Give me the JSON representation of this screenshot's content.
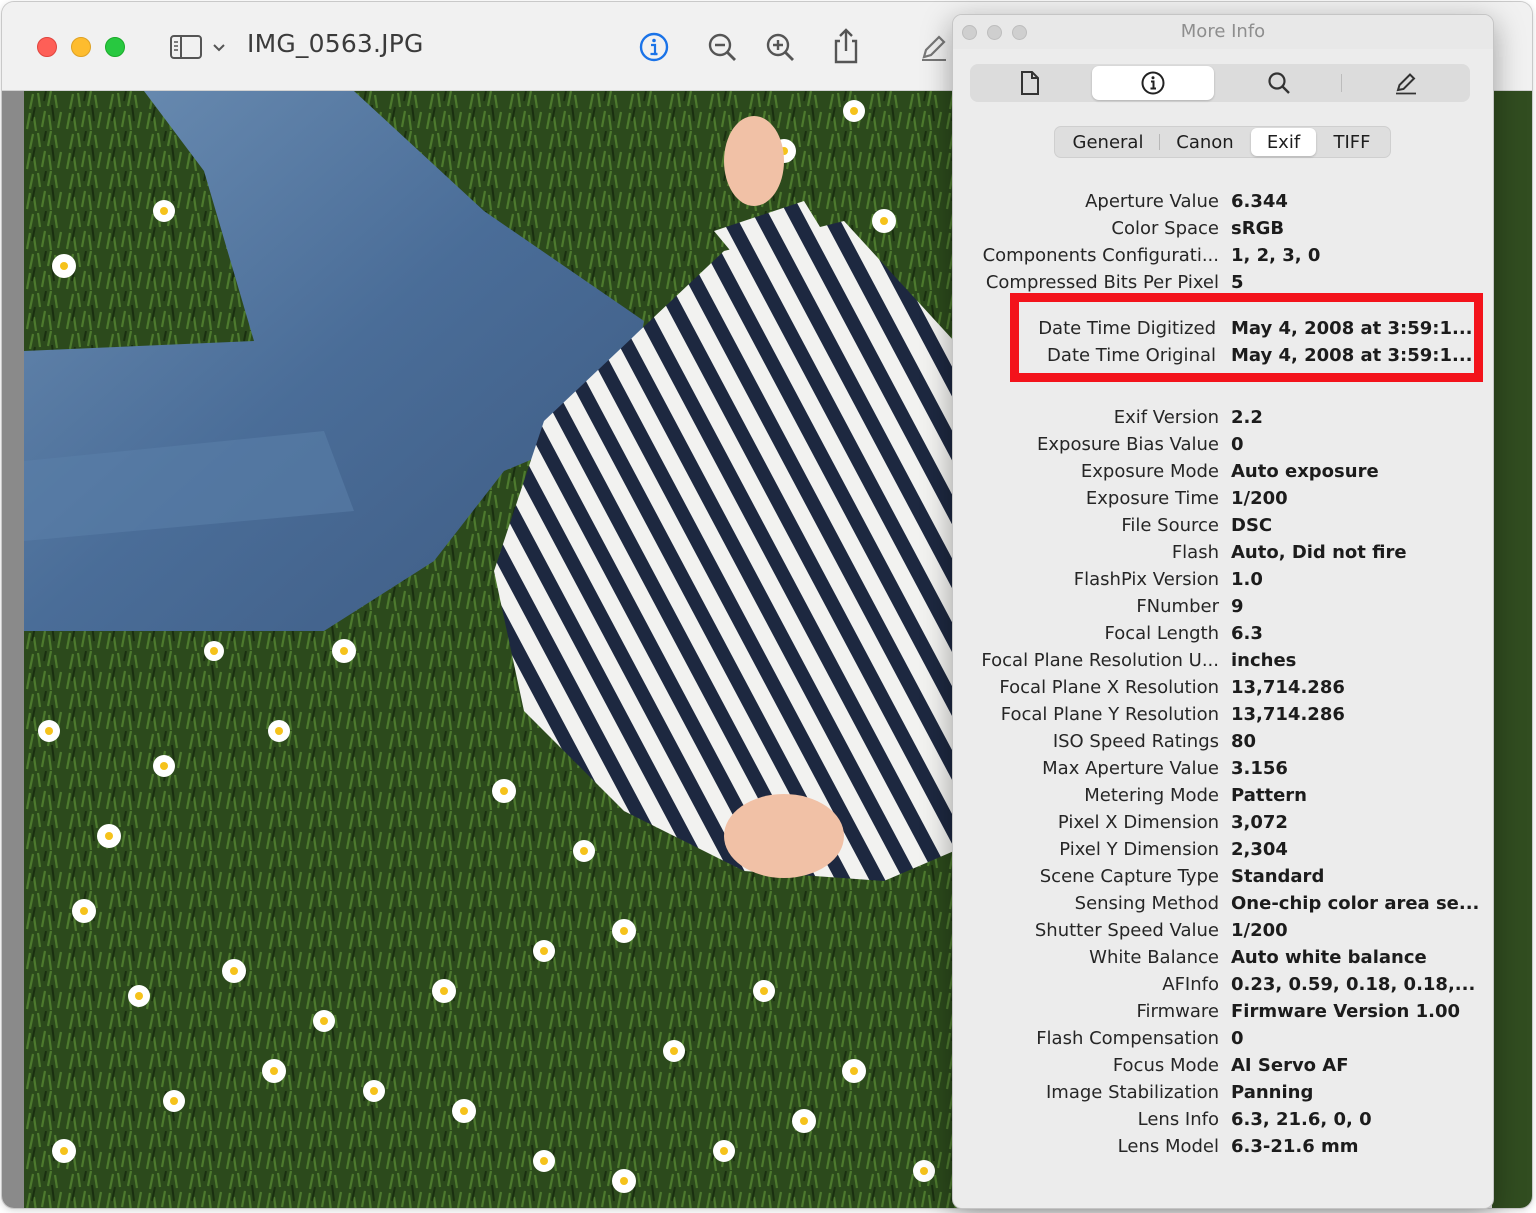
{
  "window": {
    "title": "IMG_0563.JPG"
  },
  "toolbar": {
    "icons": [
      "sidebar-icon",
      "chevron-down-icon",
      "info-icon",
      "zoom-out-icon",
      "zoom-in-icon",
      "share-icon",
      "markup-icon"
    ],
    "accent_color": "#1a73e8"
  },
  "inspector": {
    "title": "More Info",
    "tabs": [
      "document-icon",
      "info-icon",
      "search-icon",
      "pencil-icon"
    ],
    "selected_tab": "info-icon",
    "subtabs": [
      "General",
      "Canon",
      "Exif",
      "TIFF"
    ],
    "selected_subtab": "Exif",
    "properties": [
      {
        "label": "Aperture Value",
        "value": "6.344"
      },
      {
        "label": "Color Space",
        "value": "sRGB"
      },
      {
        "label": "Components Configurati...",
        "value": "1, 2, 3, 0"
      },
      {
        "label": "Compressed Bits Per Pixel",
        "value": "5"
      },
      {
        "label": "Date Time Digitized",
        "value": "May 4, 2008 at 3:59:1..."
      },
      {
        "label": "Date Time Original",
        "value": "May 4, 2008 at 3:59:1..."
      },
      {
        "label": "Exif Version",
        "value": "2.2"
      },
      {
        "label": "Exposure Bias Value",
        "value": "0"
      },
      {
        "label": "Exposure Mode",
        "value": "Auto exposure"
      },
      {
        "label": "Exposure Time",
        "value": "1/200"
      },
      {
        "label": "File Source",
        "value": "DSC"
      },
      {
        "label": "Flash",
        "value": "Auto, Did not fire"
      },
      {
        "label": "FlashPix Version",
        "value": "1.0"
      },
      {
        "label": "FNumber",
        "value": "9"
      },
      {
        "label": "Focal Length",
        "value": "6.3"
      },
      {
        "label": "Focal Plane Resolution U...",
        "value": "inches"
      },
      {
        "label": "Focal Plane X Resolution",
        "value": "13,714.286"
      },
      {
        "label": "Focal Plane Y Resolution",
        "value": "13,714.286"
      },
      {
        "label": "ISO Speed Ratings",
        "value": "80"
      },
      {
        "label": "Max Aperture Value",
        "value": "3.156"
      },
      {
        "label": "Metering Mode",
        "value": "Pattern"
      },
      {
        "label": "Pixel X Dimension",
        "value": "3,072"
      },
      {
        "label": "Pixel Y Dimension",
        "value": "2,304"
      },
      {
        "label": "Scene Capture Type",
        "value": "Standard"
      },
      {
        "label": "Sensing Method",
        "value": "One-chip color area se..."
      },
      {
        "label": "Shutter Speed Value",
        "value": "1/200"
      },
      {
        "label": "White Balance",
        "value": "Auto white balance"
      },
      {
        "label": "AFInfo",
        "value": "0.23, 0.59, 0.18, 0.18,..."
      },
      {
        "label": "Firmware",
        "value": "Firmware Version 1.00"
      },
      {
        "label": "Flash Compensation",
        "value": "0"
      },
      {
        "label": "Focus Mode",
        "value": "AI Servo AF"
      },
      {
        "label": "Image Stabilization",
        "value": "Panning"
      },
      {
        "label": "Lens Info",
        "value": "6.3, 21.6, 0, 0"
      },
      {
        "label": "Lens Model",
        "value": "6.3-21.6 mm"
      }
    ],
    "highlight_color": "#f3131b"
  }
}
